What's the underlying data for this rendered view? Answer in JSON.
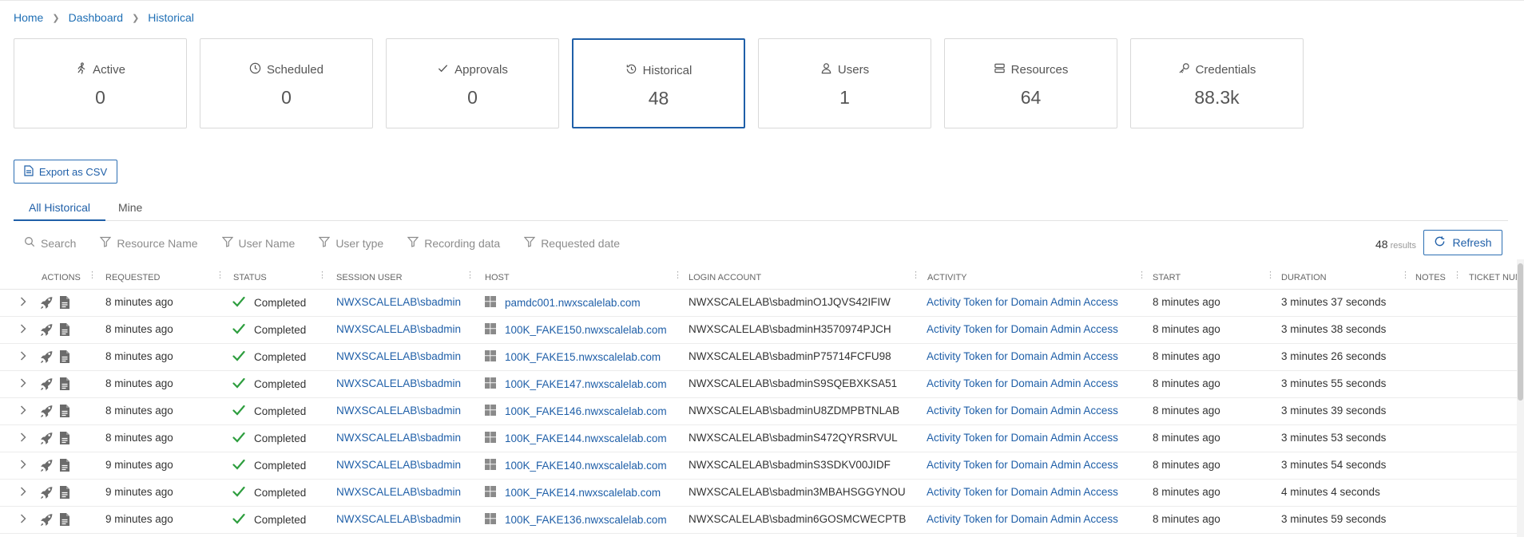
{
  "breadcrumb": [
    "Home",
    "Dashboard",
    "Historical"
  ],
  "cards": [
    {
      "label": "Active",
      "value": "0",
      "icon": "running-icon"
    },
    {
      "label": "Scheduled",
      "value": "0",
      "icon": "clock-icon"
    },
    {
      "label": "Approvals",
      "value": "0",
      "icon": "check-icon"
    },
    {
      "label": "Historical",
      "value": "48",
      "icon": "history-icon"
    },
    {
      "label": "Users",
      "value": "1",
      "icon": "user-icon"
    },
    {
      "label": "Resources",
      "value": "64",
      "icon": "server-icon"
    },
    {
      "label": "Credentials",
      "value": "88.3k",
      "icon": "key-icon"
    }
  ],
  "selected_card": "Historical",
  "export_label": "Export as CSV",
  "tabs": {
    "all": "All Historical",
    "mine": "Mine"
  },
  "filters": {
    "search": "Search",
    "resource_name": "Resource Name",
    "user_name": "User Name",
    "user_type": "User type",
    "recording_data": "Recording data",
    "requested_date": "Requested date"
  },
  "results": {
    "count": "48",
    "label": "results"
  },
  "refresh_label": "Refresh",
  "columns": {
    "actions": "Actions",
    "requested": "Requested",
    "status": "Status",
    "session_user": "Session user",
    "host": "Host",
    "login_account": "Login account",
    "activity": "Activity",
    "start": "Start",
    "duration": "Duration",
    "notes": "Notes",
    "ticket": "Ticket num"
  },
  "rows": [
    {
      "requested": "8 minutes ago",
      "status": "Completed",
      "user": "NWXSCALELAB\\sbadmin",
      "host": "pamdc001.nwxscalelab.com",
      "login": "NWXSCALELAB\\sbadminO1JQVS42IFIW",
      "activity": "Activity Token for Domain Admin Access",
      "start": "8 minutes ago",
      "duration": "3 minutes 37 seconds"
    },
    {
      "requested": "8 minutes ago",
      "status": "Completed",
      "user": "NWXSCALELAB\\sbadmin",
      "host": "100K_FAKE150.nwxscalelab.com",
      "login": "NWXSCALELAB\\sbadminH3570974PJCH",
      "activity": "Activity Token for Domain Admin Access",
      "start": "8 minutes ago",
      "duration": "3 minutes 38 seconds"
    },
    {
      "requested": "8 minutes ago",
      "status": "Completed",
      "user": "NWXSCALELAB\\sbadmin",
      "host": "100K_FAKE15.nwxscalelab.com",
      "login": "NWXSCALELAB\\sbadminP75714FCFU98",
      "activity": "Activity Token for Domain Admin Access",
      "start": "8 minutes ago",
      "duration": "3 minutes 26 seconds"
    },
    {
      "requested": "8 minutes ago",
      "status": "Completed",
      "user": "NWXSCALELAB\\sbadmin",
      "host": "100K_FAKE147.nwxscalelab.com",
      "login": "NWXSCALELAB\\sbadminS9SQEBXKSA51",
      "activity": "Activity Token for Domain Admin Access",
      "start": "8 minutes ago",
      "duration": "3 minutes 55 seconds"
    },
    {
      "requested": "8 minutes ago",
      "status": "Completed",
      "user": "NWXSCALELAB\\sbadmin",
      "host": "100K_FAKE146.nwxscalelab.com",
      "login": "NWXSCALELAB\\sbadminU8ZDMPBTNLAB",
      "activity": "Activity Token for Domain Admin Access",
      "start": "8 minutes ago",
      "duration": "3 minutes 39 seconds"
    },
    {
      "requested": "8 minutes ago",
      "status": "Completed",
      "user": "NWXSCALELAB\\sbadmin",
      "host": "100K_FAKE144.nwxscalelab.com",
      "login": "NWXSCALELAB\\sbadminS472QYRSRVUL",
      "activity": "Activity Token for Domain Admin Access",
      "start": "8 minutes ago",
      "duration": "3 minutes 53 seconds"
    },
    {
      "requested": "9 minutes ago",
      "status": "Completed",
      "user": "NWXSCALELAB\\sbadmin",
      "host": "100K_FAKE140.nwxscalelab.com",
      "login": "NWXSCALELAB\\sbadminS3SDKV00JIDF",
      "activity": "Activity Token for Domain Admin Access",
      "start": "8 minutes ago",
      "duration": "3 minutes 54 seconds"
    },
    {
      "requested": "9 minutes ago",
      "status": "Completed",
      "user": "NWXSCALELAB\\sbadmin",
      "host": "100K_FAKE14.nwxscalelab.com",
      "login": "NWXSCALELAB\\sbadmin3MBAHSGGYNOU",
      "activity": "Activity Token for Domain Admin Access",
      "start": "8 minutes ago",
      "duration": "4 minutes 4 seconds"
    },
    {
      "requested": "9 minutes ago",
      "status": "Completed",
      "user": "NWXSCALELAB\\sbadmin",
      "host": "100K_FAKE136.nwxscalelab.com",
      "login": "NWXSCALELAB\\sbadmin6GOSMCWECPTB",
      "activity": "Activity Token for Domain Admin Access",
      "start": "8 minutes ago",
      "duration": "3 minutes 59 seconds"
    }
  ],
  "colors": {
    "accent": "#1f5fa8",
    "success": "#2e9e3f"
  }
}
